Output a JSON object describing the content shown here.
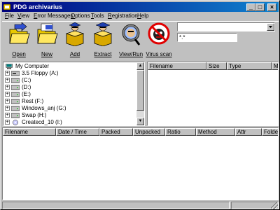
{
  "window": {
    "title": "PDG archivarius"
  },
  "menu": [
    {
      "label": "File",
      "key": "F",
      "rest": "ile"
    },
    {
      "label": "View",
      "key": "V",
      "rest": "iew"
    },
    {
      "label": "Error Messages",
      "key": "E",
      "rest": "rror Messages"
    },
    {
      "label": "Options",
      "key": "O",
      "rest": "ptions"
    },
    {
      "label": "Tools",
      "key": "T",
      "rest": "ools"
    },
    {
      "label": "Registration",
      "key": "R",
      "rest": "egistration"
    },
    {
      "label": "Help",
      "key": "H",
      "rest": "elp"
    }
  ],
  "toolbar": {
    "open": "Open",
    "new": "New",
    "add": "Add",
    "extract": "Extract",
    "view_run": "View/Run",
    "virus_scan": "Virus scan"
  },
  "path_combo": {
    "value": ""
  },
  "filter": {
    "value": "*.*"
  },
  "tree": [
    {
      "label": "My Computer",
      "expander": false,
      "icon": "computer-icon"
    },
    {
      "label": "3.5 Floppy (A:)",
      "expander": true,
      "icon": "floppy-icon"
    },
    {
      "label": "(C:)",
      "expander": true,
      "icon": "drive-icon"
    },
    {
      "label": "(D:)",
      "expander": true,
      "icon": "drive-icon"
    },
    {
      "label": "(E:)",
      "expander": true,
      "icon": "drive-icon"
    },
    {
      "label": "Rest (F:)",
      "expander": true,
      "icon": "drive-icon"
    },
    {
      "label": "Windows_anj (G:)",
      "expander": true,
      "icon": "drive-icon"
    },
    {
      "label": "Swap (H:)",
      "expander": true,
      "icon": "drive-icon"
    },
    {
      "label": "Createcd_10 (I:)",
      "expander": true,
      "icon": "cd-icon"
    }
  ],
  "file_columns": [
    "Filename",
    "Size",
    "Type",
    "Mo"
  ],
  "archive_columns": [
    "Filename",
    "Date / Time",
    "Packed",
    "Unpacked",
    "Ratio",
    "Method",
    "Attr",
    "Folder"
  ],
  "colors": {
    "titlebar_start": "#000080",
    "titlebar_end": "#1084d0",
    "face": "#c0c0c0"
  }
}
